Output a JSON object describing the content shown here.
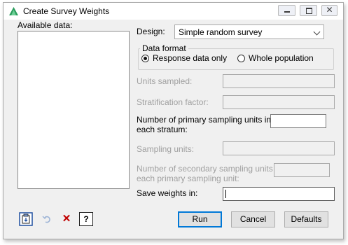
{
  "window": {
    "title": "Create Survey Weights"
  },
  "titlebar": {
    "minimize_icon": "minimize-icon",
    "maximize_icon": "maximize-icon",
    "close_glyph": "✕"
  },
  "available_data": {
    "label": "Available data:",
    "items": []
  },
  "design": {
    "label": "Design:",
    "selected": "Simple random survey"
  },
  "data_format": {
    "legend": "Data format",
    "options": [
      "Response data only",
      "Whole population"
    ],
    "selected_index": 0
  },
  "fields": {
    "units_sampled": {
      "label": "Units sampled:",
      "value": ""
    },
    "stratification_factor": {
      "label": "Stratification factor:",
      "value": ""
    },
    "primary_units": {
      "label_line1": "Number of primary sampling units in",
      "label_line2": "each stratum:",
      "value": ""
    },
    "sampling_units": {
      "label": "Sampling units:",
      "value": ""
    },
    "secondary_units": {
      "label_line1": "Number of secondary sampling units in",
      "label_line2": "each primary sampling unit:",
      "value": ""
    },
    "save_weights": {
      "label": "Save weights in:",
      "value": ""
    }
  },
  "buttons": {
    "run": "Run",
    "cancel": "Cancel",
    "defaults": "Defaults"
  },
  "toolbar": {
    "help_glyph": "?",
    "clear_glyph": "✕"
  },
  "colors": {
    "accent": "#0078d7",
    "disabled_text": "#a0a0a0",
    "clear_red": "#c00000"
  }
}
